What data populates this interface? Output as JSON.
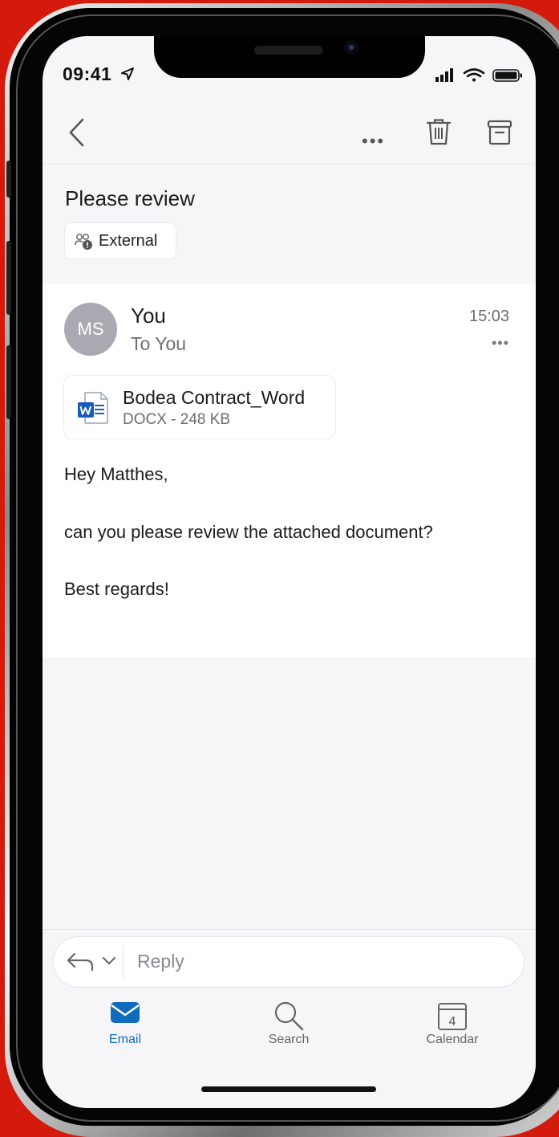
{
  "status": {
    "time": "09:41"
  },
  "message": {
    "subject": "Please review",
    "tag": "External",
    "avatar_initials": "MS",
    "sender": "You",
    "recipient": "To You",
    "time": "15:03",
    "attachment": {
      "name": "Bodea Contract_Word",
      "meta": "DOCX - 248 KB",
      "icon": "word-doc-icon"
    },
    "body": [
      "Hey Matthes,",
      "can you please review the attached document?",
      "Best regards!"
    ]
  },
  "reply": {
    "placeholder": "Reply"
  },
  "tabs": [
    {
      "label": "Email",
      "icon": "mail-icon",
      "active": true
    },
    {
      "label": "Search",
      "icon": "search-icon",
      "active": false
    },
    {
      "label": "Calendar",
      "icon": "calendar-icon",
      "badge": "4",
      "active": false
    }
  ],
  "colors": {
    "accent": "#0f6cbd",
    "background": "#d41a0c"
  }
}
